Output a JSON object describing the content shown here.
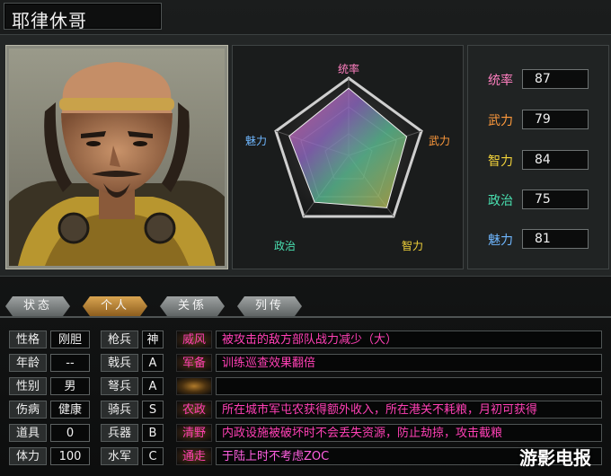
{
  "character": {
    "name": "耶律休哥"
  },
  "radar": {
    "labels": {
      "tongshuai": "统率",
      "wuli": "武力",
      "zhili": "智力",
      "zhengzhi": "政治",
      "meili": "魅力"
    },
    "values": {
      "tongshuai": 87,
      "wuli": 79,
      "zhili": 84,
      "zhengzhi": 75,
      "meili": 81
    }
  },
  "stats": [
    {
      "label": "统率",
      "value": "87",
      "color": "#ff7fc0"
    },
    {
      "label": "武力",
      "value": "79",
      "color": "#ff9a3c"
    },
    {
      "label": "智力",
      "value": "84",
      "color": "#f2d23a"
    },
    {
      "label": "政治",
      "value": "75",
      "color": "#49e0b0"
    },
    {
      "label": "魅力",
      "value": "81",
      "color": "#6fb7ff"
    }
  ],
  "tabs": [
    "状态",
    "个人",
    "关係",
    "列传"
  ],
  "active_tab": "个人",
  "info": {
    "rows": [
      {
        "k": "性格",
        "v": "刚胆",
        "t": "枪兵",
        "r": "神"
      },
      {
        "k": "年龄",
        "v": "--",
        "t": "戟兵",
        "r": "A"
      },
      {
        "k": "性别",
        "v": "男",
        "t": "弩兵",
        "r": "A"
      },
      {
        "k": "伤病",
        "v": "健康",
        "t": "骑兵",
        "r": "S"
      },
      {
        "k": "道具",
        "v": "0",
        "t": "兵器",
        "r": "B"
      },
      {
        "k": "体力",
        "v": "100",
        "t": "水军",
        "r": "C"
      }
    ]
  },
  "skills": [
    {
      "name": "威风",
      "desc": "被攻击的敌方部队战力减少（大）"
    },
    {
      "name": "军备",
      "desc": "训练巡查效果翻倍"
    },
    {
      "name": "",
      "desc": ""
    },
    {
      "name": "农政",
      "desc": "所在城市军屯农获得额外收入，所在港关不耗粮，月初可获得"
    },
    {
      "name": "清野",
      "desc": "内政设施被破坏时不会丢失资源，防止劫掠，攻击截粮"
    },
    {
      "name": "通走",
      "desc": "于陆上时不考虑ZOC"
    }
  ],
  "watermark": "游影电报"
}
